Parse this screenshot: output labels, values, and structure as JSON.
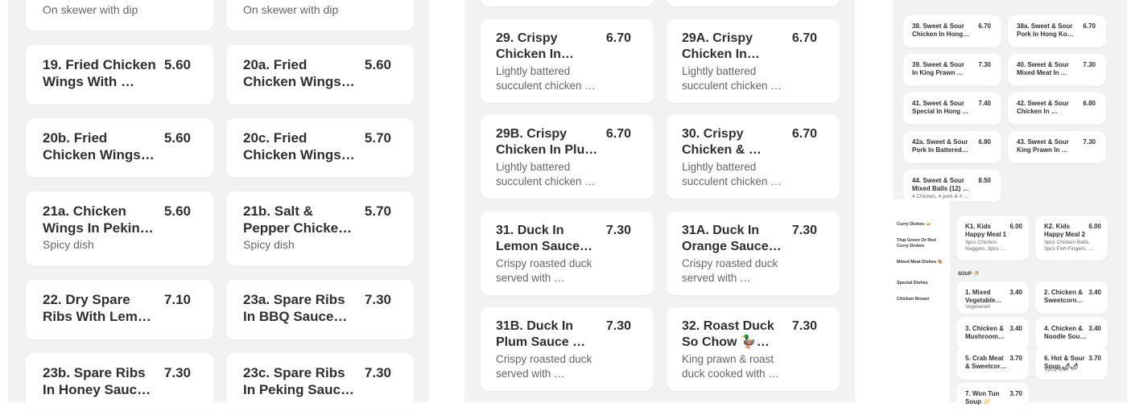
{
  "left_column_a": [
    {
      "name": "",
      "price": "",
      "desc": "On skewer with dip"
    },
    {
      "name": "19. Fried Chicken Wings With …",
      "price": "5.60",
      "desc": ""
    },
    {
      "name": "20b. Fried Chicken Wings I…",
      "price": "5.60",
      "desc": ""
    },
    {
      "name": "21a. Chicken Wings In Peking …",
      "price": "5.60",
      "desc": "Spicy dish"
    },
    {
      "name": "22. Dry Spare Ribs With Lemon 🍋🍋…",
      "price": "7.10",
      "desc": ""
    },
    {
      "name": "23b. Spare Ribs In Honey Sauce 🍯🍯",
      "price": "7.30",
      "desc": ""
    }
  ],
  "left_column_b": [
    {
      "name": "",
      "price": "",
      "desc": "On skewer with dip"
    },
    {
      "name": "20a. Fried Chicken Wings In BBQ …",
      "price": "5.60",
      "desc": ""
    },
    {
      "name": "20c. Fried Chicken Wings In Sweet …",
      "price": "5.70",
      "desc": ""
    },
    {
      "name": "21b. Salt & Pepper Chicken Wings 🌶…",
      "price": "5.70",
      "desc": "Spicy dish"
    },
    {
      "name": "23a. Spare Ribs In BBQ Sauce BBQ🍖",
      "price": "7.30",
      "desc": ""
    },
    {
      "name": "23c. Spare Ribs In Peking Sauce 🍖🍖",
      "price": "7.30",
      "desc": ""
    }
  ],
  "mid_column_a": [
    {
      "name": "29. Crispy Chicken In Lemo…",
      "price": "6.70",
      "desc": "Lightly battered succulent chicken …"
    },
    {
      "name": "29B. Crispy Chicken In Plum …",
      "price": "6.70",
      "desc": "Lightly battered succulent chicken …"
    },
    {
      "name": "31. Duck In Lemon Sauce 🦆🦆🍋",
      "price": "7.30",
      "desc": "Crispy roasted duck served with …"
    },
    {
      "name": "31B. Duck In Plum Sauce 🦆🦆🍑",
      "price": "7.30",
      "desc": "Crispy roasted duck served with …"
    }
  ],
  "mid_column_b": [
    {
      "name": "29A. Crispy Chicken In Oran…",
      "price": "6.70",
      "desc": "Lightly battered succulent chicken …"
    },
    {
      "name": "30. Crispy Chicken & …",
      "price": "6.70",
      "desc": "Lightly battered succulent chicken …"
    },
    {
      "name": "31A. Duck In Orange Sauce 🦆🍊",
      "price": "7.30",
      "desc": "Crispy roasted duck served with …"
    },
    {
      "name": "32. Roast Duck So Chow 🦆🦆🍜",
      "price": "7.30",
      "desc": "King prawn & roast duck cooked with …"
    }
  ],
  "right_top_a": [
    {
      "name": "38. Sweet & Sour Chicken In Hong …",
      "price": "6.70",
      "desc": ""
    },
    {
      "name": "39. Sweet & Sour In King Prawn …",
      "price": "7.30",
      "desc": ""
    },
    {
      "name": "41. Sweet & Sour Special In Hong …",
      "price": "7.40",
      "desc": ""
    },
    {
      "name": "42a. Sweet & Sour Pork In Battered…",
      "price": "6.80",
      "desc": ""
    },
    {
      "name": "44. Sweet & Sour Mixed Balls (12) …",
      "price": "8.50",
      "desc": "4 Chicken, 4 pork & 4 …"
    }
  ],
  "right_top_b": [
    {
      "name": "38a. Sweet & Sour Pork In Hong Ko…",
      "price": "6.70",
      "desc": ""
    },
    {
      "name": "40. Sweet & Sour Mixed Meat In …",
      "price": "7.30",
      "desc": ""
    },
    {
      "name": "42. Sweet & Sour Chicken In …",
      "price": "6.80",
      "desc": ""
    },
    {
      "name": "43. Sweet & Sour King Prawn In …",
      "price": "7.30",
      "desc": ""
    }
  ],
  "right_sidebar": [
    "Curry Dishes 🍛",
    "Thai Green Or Red Curry Dishes",
    "Mixed Meat Dishes 🍖",
    "Special Dishes",
    "Chicken Breast"
  ],
  "right_kids": [
    {
      "name": "K1. Kids Happy Meal 1",
      "price": "6.00",
      "desc": "3pcs Chicken Nuggets, 3pcs …"
    },
    {
      "name": "K2. Kids Happy Meal 2",
      "price": "6.00",
      "desc": "3pcs Chicken Balls, 3pcs Fish Fingers, …"
    }
  ],
  "soup_heading": "SOUP 🍜",
  "right_soup_a": [
    {
      "name": "1. Mixed Vegetable Soup …",
      "price": "3.40",
      "desc": "Vegetarian"
    },
    {
      "name": "3. Chicken & Mushroom Soup …",
      "price": "3.40",
      "desc": ""
    },
    {
      "name": "5. Crab Meat & Sweetcorn Soup …",
      "price": "3.70",
      "desc": ""
    },
    {
      "name": "7. Won Tun Soup 🥟",
      "price": "3.70",
      "desc": ""
    }
  ],
  "right_soup_b": [
    {
      "name": "2. Chicken & Sweetcorn Soup …",
      "price": "3.40",
      "desc": ""
    },
    {
      "name": "4. Chicken & Noodle Soup 🍜🍜",
      "price": "3.40",
      "desc": ""
    },
    {
      "name": "6. Hot & Sour Soup 🌶🌶",
      "price": "3.70",
      "desc": "Spicy dish"
    }
  ]
}
